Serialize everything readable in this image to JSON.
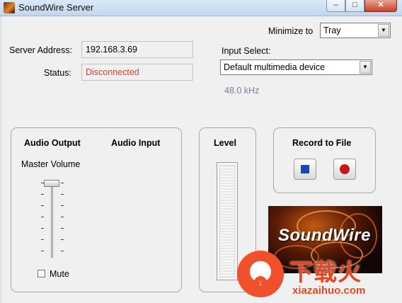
{
  "window": {
    "title": "SoundWire Server",
    "minimize_glyph": "–",
    "maximize_glyph": "□",
    "close_glyph": "✕"
  },
  "server": {
    "address_label": "Server Address:",
    "address_value": "192.168.3.69",
    "status_label": "Status:",
    "status_value": "Disconnected",
    "status_color": "#e0401c"
  },
  "minimize": {
    "label": "Minimize to",
    "selected": "Tray"
  },
  "input_select": {
    "label": "Input Select:",
    "selected": "Default multimedia device",
    "sample_rate": "48.0 kHz",
    "sample_rate_color": "#7a7aa8"
  },
  "audio_group": {
    "output_label": "Audio Output",
    "input_label": "Audio Input",
    "master_volume_label": "Master Volume",
    "mute_label": "Mute",
    "mute_checked": false,
    "master_volume_level": 1.0
  },
  "level_group": {
    "label": "Level"
  },
  "record_group": {
    "label": "Record to File",
    "stop_color": "#1848b8",
    "record_color": "#c81818"
  },
  "logo": {
    "text": "SoundWire"
  },
  "watermark": {
    "title": "下载火",
    "url": "xiazaihuo.com",
    "color": "#e8451f"
  },
  "icons": {
    "app": "soundwire-app-icon",
    "stop": "stop-icon",
    "record": "record-icon",
    "dropdown": "chevron-down-icon"
  }
}
